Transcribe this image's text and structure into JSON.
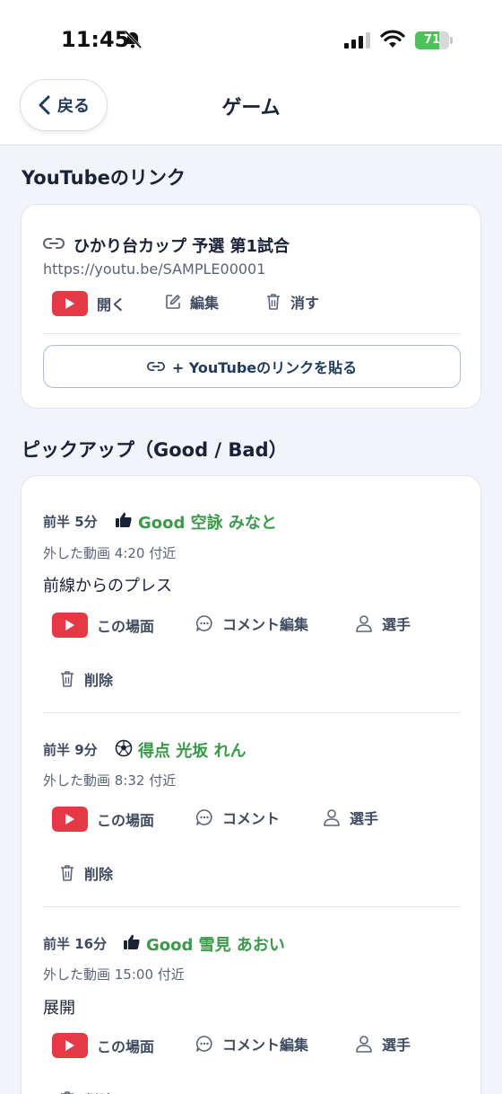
{
  "status": {
    "time": "11:45",
    "battery": "71",
    "battery_level": 71
  },
  "nav": {
    "back_label": "戻る",
    "title": "ゲーム"
  },
  "youtube_section": {
    "title": "YouTubeのリンク",
    "link": {
      "title": "ひかり台カップ 予選 第1試合",
      "url": "https://youtu.be/SAMPLE00001",
      "open_label": "開く",
      "edit_label": "編集",
      "delete_label": "消す"
    },
    "paste_label": "+ YouTubeのリンクを貼る"
  },
  "pickup_section": {
    "title": "ピックアップ（Good / Bad）",
    "items": [
      {
        "time": "前半 5分",
        "tag": "Good 空詠 みなと",
        "icon": "thumbs-up-icon",
        "sub": "外した動画 4:20 付近",
        "comment": "前線からのプレス",
        "scene_label": "この場面",
        "comment_label": "コメント編集",
        "player_label": "選手",
        "delete_label": "削除"
      },
      {
        "time": "前半 9分",
        "tag": "得点 光坂 れん",
        "icon": "soccer-ball-icon",
        "sub": "外した動画 8:32 付近",
        "comment": "",
        "scene_label": "この場面",
        "comment_label": "コメント",
        "player_label": "選手",
        "delete_label": "削除"
      },
      {
        "time": "前半 16分",
        "tag": "Good 雪見 あおい",
        "icon": "thumbs-up-icon",
        "sub": "外した動画 15:00 付近",
        "comment": "展開",
        "scene_label": "この場面",
        "comment_label": "コメント編集",
        "player_label": "選手",
        "delete_label": "削除"
      }
    ]
  },
  "colors": {
    "accent_green": "#3a9a4a",
    "youtube_red": "#e63946",
    "navy": "#1e3a5f"
  }
}
